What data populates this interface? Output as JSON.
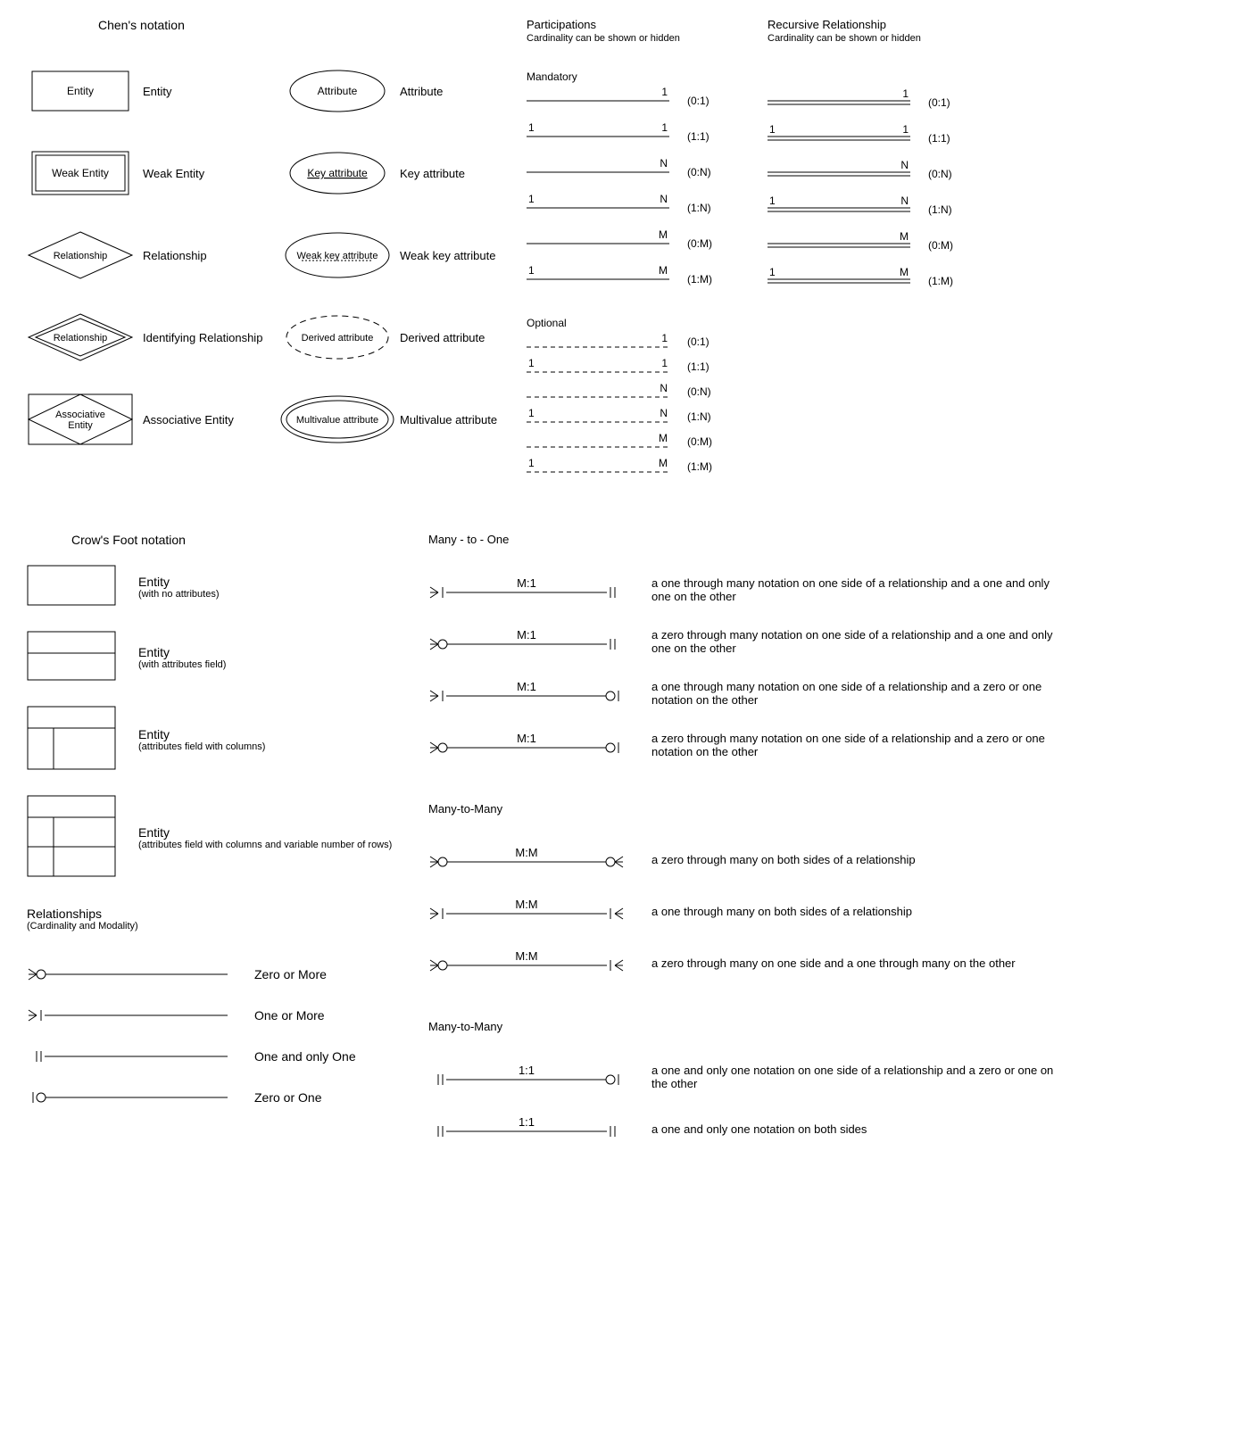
{
  "chen": {
    "title": "Chen's notation",
    "entity": {
      "shape": "Entity",
      "label": "Entity"
    },
    "weakEntity": {
      "shape": "Weak Entity",
      "label": "Weak Entity"
    },
    "relationship": {
      "shape": "Relationship",
      "label": "Relationship"
    },
    "identRelationship": {
      "shape": "Relationship",
      "label": "Identifying Relationship"
    },
    "assocEntity": {
      "shape": "Associative Entity",
      "label": "Associative Entity"
    },
    "attribute": {
      "shape": "Attribute",
      "label": "Attribute"
    },
    "keyAttribute": {
      "shape": "Key attribute",
      "label": "Key attribute"
    },
    "weakKeyAttribute": {
      "shape": "Weak key attribute",
      "label": "Weak key attribute"
    },
    "derivedAttribute": {
      "shape": "Derived attribute",
      "label": "Derived attribute"
    },
    "multivalueAttribute": {
      "shape": "Multivalue attribute",
      "label": "Multivalue attribute"
    }
  },
  "part": {
    "title": "Participations",
    "caption": "Cardinality can be shown or hidden",
    "mandatory": "Mandatory",
    "optional": "Optional",
    "rows": [
      {
        "left": "",
        "right": "1",
        "card": "(0:1)"
      },
      {
        "left": "1",
        "right": "1",
        "card": "(1:1)"
      },
      {
        "left": "",
        "right": "N",
        "card": "(0:N)"
      },
      {
        "left": "1",
        "right": "N",
        "card": "(1:N)"
      },
      {
        "left": "",
        "right": "M",
        "card": "(0:M)"
      },
      {
        "left": "1",
        "right": "M",
        "card": "(1:M)"
      }
    ]
  },
  "recursive": {
    "title": "Recursive Relationship",
    "caption": "Cardinality can be shown or hidden"
  },
  "crow": {
    "title": "Crow's Foot notation",
    "entities": [
      {
        "label": "Entity",
        "sub": "(with no attributes)"
      },
      {
        "label": "Entity",
        "sub": "(with attributes field)"
      },
      {
        "label": "Entity",
        "sub": "(attributes field with columns)"
      },
      {
        "label": "Entity",
        "sub": "(attributes field with columns and variable number of rows)"
      }
    ],
    "relTitle": "Relationships",
    "relCaption": "(Cardinality and Modality)",
    "legend": [
      "Zero or More",
      "One or More",
      "One and only One",
      "Zero or One"
    ]
  },
  "rels": {
    "m1": {
      "title": "Many - to - One",
      "rows": [
        {
          "ratio": "M:1",
          "desc": "a one through many notation on one side of a relationship and a one and only one on the other"
        },
        {
          "ratio": "M:1",
          "desc": "a zero through many notation on one side of a relationship and a one and only one on the other"
        },
        {
          "ratio": "M:1",
          "desc": "a one through many notation on one side of a relationship and a zero or one notation on the other"
        },
        {
          "ratio": "M:1",
          "desc": "a zero through many notation on one side of a relationship and a zero or one notation on the other"
        }
      ]
    },
    "mm": {
      "title": "Many-to-Many",
      "rows": [
        {
          "ratio": "M:M",
          "desc": "a zero through many on both sides of a relationship"
        },
        {
          "ratio": "M:M",
          "desc": "a one through many on both sides of a relationship"
        },
        {
          "ratio": "M:M",
          "desc": "a zero through many on one side and a one through many on the other"
        }
      ]
    },
    "oo": {
      "title": "Many-to-Many",
      "rows": [
        {
          "ratio": "1:1",
          "desc": "a one and only one notation on one side of a relationship and a zero or one on the other"
        },
        {
          "ratio": "1:1",
          "desc": "a one and only one notation on both sides"
        }
      ]
    }
  }
}
